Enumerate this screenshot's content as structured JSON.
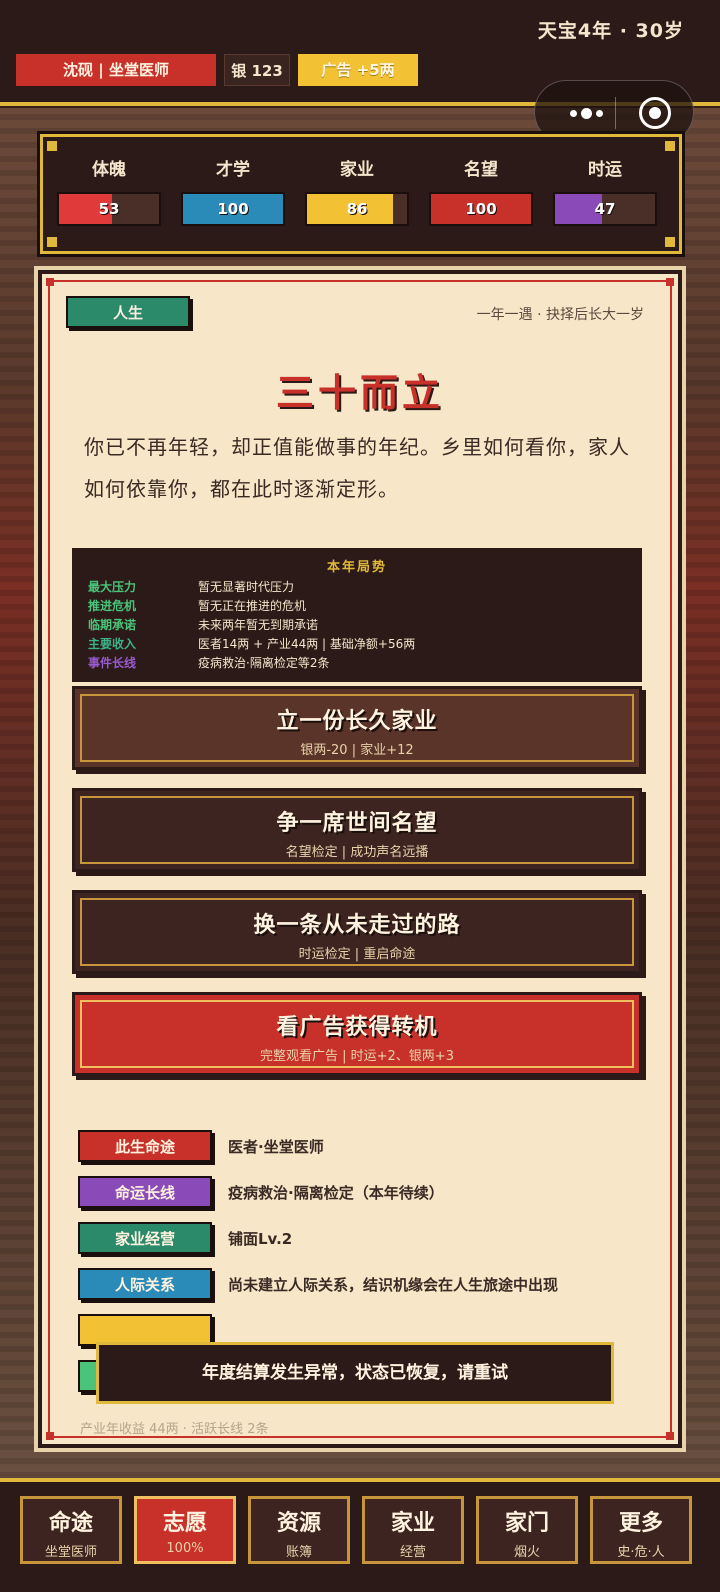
{
  "header": {
    "era": "天宝4年 · 30岁",
    "player": "沈砚 | 坐堂医师",
    "silver": "银 123",
    "ad": "广告 +5两"
  },
  "stats": [
    {
      "label": "体魄",
      "value": "53",
      "level": 0.53,
      "color": "#e03a3a"
    },
    {
      "label": "才学",
      "value": "100",
      "level": 1.0,
      "color": "#2a8ab8"
    },
    {
      "label": "家业",
      "value": "86",
      "level": 0.86,
      "color": "#f2c234"
    },
    {
      "label": "名望",
      "value": "100",
      "level": 1.0,
      "color": "#c8302a"
    },
    {
      "label": "时运",
      "value": "47",
      "level": 0.47,
      "color": "#8a4ab8"
    }
  ],
  "card": {
    "tag": "人生",
    "hint": "一年一遇 · 抉择后长大一岁",
    "title": "三十而立",
    "story": "你已不再年轻，却正值能做事的年纪。乡里如何看你，家人如何依靠你，都在此时逐渐定形。"
  },
  "situation": {
    "title": "本年局势",
    "rows": [
      {
        "key": "最大压力",
        "value": "暂无显著时代压力",
        "color": "#4ac47a"
      },
      {
        "key": "推进危机",
        "value": "暂无正在推进的危机",
        "color": "#4ac47a"
      },
      {
        "key": "临期承诺",
        "value": "未来两年暂无到期承诺",
        "color": "#4ac47a"
      },
      {
        "key": "主要收入",
        "value": "医者14两 + 产业44两 | 基础净额+56两",
        "color": "#3ab48a"
      },
      {
        "key": "事件长线",
        "value": "疫病救治·隔离检定等2条",
        "color": "#9a5ad0"
      }
    ]
  },
  "choices": [
    {
      "title": "立一份长久家业",
      "sub": "银两-20 | 家业+12"
    },
    {
      "title": "争一席世间名望",
      "sub": "名望检定 | 成功声名远播"
    },
    {
      "title": "换一条从未走过的路",
      "sub": "时运检定 | 重启命途"
    },
    {
      "title": "看广告获得转机",
      "sub": "完整观看广告 | 时运+2、银两+3"
    }
  ],
  "info": [
    {
      "tag": "此生命途",
      "value": "医者·坐堂医师",
      "color": "#c8302a"
    },
    {
      "tag": "命运长线",
      "value": "疫病救治·隔离检定（本年待续）",
      "color": "#8a4ab8"
    },
    {
      "tag": "家业经营",
      "value": "铺面Lv.2",
      "color": "#2a8a6a"
    },
    {
      "tag": "人际关系",
      "value": "尚未建立人际关系，结识机缘会在人生旅途中出现",
      "color": "#2a8ab8"
    }
  ],
  "footer_note": "产业年收益 44两 · 活跃长线 2条",
  "toast": "年度结算发生异常，状态已恢复，请重试",
  "nav": [
    {
      "label": "命途",
      "sub": "坐堂医师"
    },
    {
      "label": "志愿",
      "sub": "100%"
    },
    {
      "label": "资源",
      "sub": "账簿"
    },
    {
      "label": "家业",
      "sub": "经营"
    },
    {
      "label": "家门",
      "sub": "烟火"
    },
    {
      "label": "更多",
      "sub": "史·危·人"
    }
  ]
}
